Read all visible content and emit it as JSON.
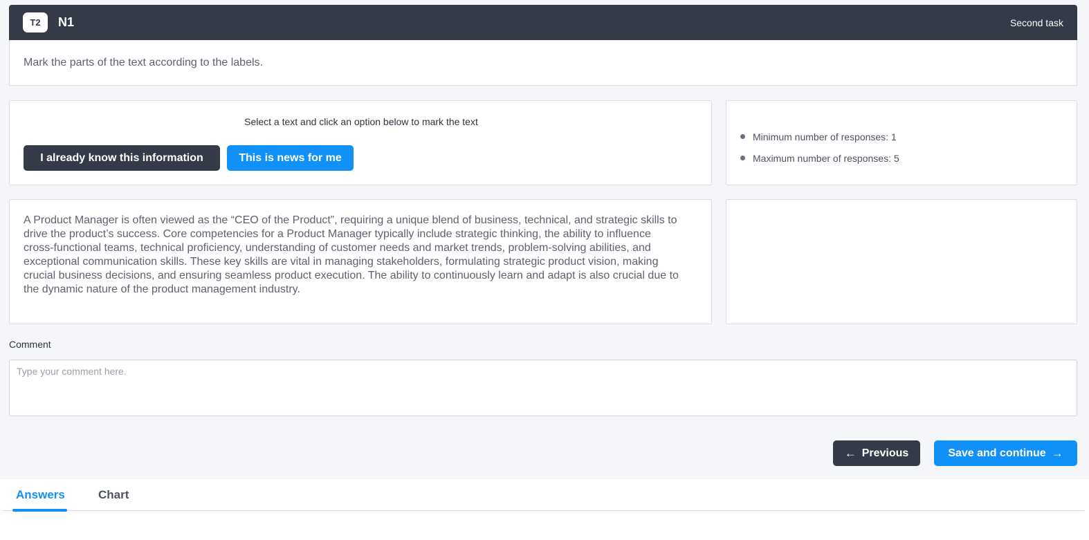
{
  "header": {
    "badge": "T2",
    "task_name": "N1",
    "task_label": "Second task"
  },
  "instruction": "Mark the parts of the text according to the labels.",
  "selection": {
    "hint": "Select a text and click an option below to mark the text",
    "options": [
      {
        "label": "I already know this information",
        "color": "#343a48"
      },
      {
        "label": "This is news for me",
        "color": "#1190f7"
      }
    ]
  },
  "rules": [
    "Minimum number of responses: 1",
    "Maximum number of responses: 5"
  ],
  "passage": "A Product Manager is often viewed as the “CEO of the Product”, requiring a unique blend of business, technical, and strategic skills to drive the product’s success. Core competencies for a Product Manager typically include strategic thinking, the ability to influence cross-functional teams, technical proficiency, understanding of customer needs and market trends, problem-solving abilities, and exceptional communication skills. These key skills are vital in managing stakeholders, formulating strategic product vision, making crucial business decisions, and ensuring seamless product execution. The ability to continuously learn and adapt is also crucial due to the dynamic nature of the product management industry.",
  "comment": {
    "label": "Comment",
    "value": "",
    "placeholder": "Type your comment here."
  },
  "navigation": {
    "previous_label": "Previous",
    "next_label": "Save and continue",
    "previous_icon": "arrow-left-icon",
    "next_icon": "arrow-right-icon"
  },
  "tabs": [
    {
      "label": "Answers",
      "active": true
    },
    {
      "label": "Chart",
      "active": false
    }
  ],
  "colors": {
    "accent": "#1190f7",
    "dark": "#343a48"
  }
}
